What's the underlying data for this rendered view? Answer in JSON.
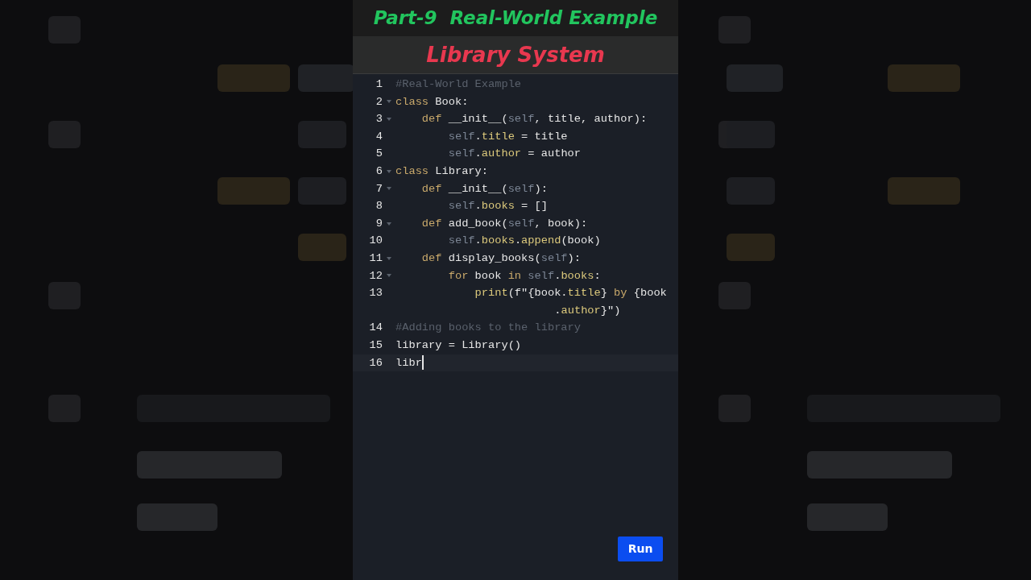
{
  "title": "Part-9  Real-World Example",
  "subtitle": "Library System",
  "editor": {
    "lines": [
      {
        "number": "1",
        "foldable": false,
        "current": false,
        "tokens": [
          {
            "kind": "comment",
            "text": "#Real-World Example"
          }
        ]
      },
      {
        "number": "2",
        "foldable": true,
        "current": false,
        "tokens": [
          {
            "kind": "keyword",
            "text": "class"
          },
          {
            "kind": "plain",
            "text": " Book:"
          }
        ]
      },
      {
        "number": "3",
        "foldable": true,
        "current": false,
        "tokens": [
          {
            "kind": "keyword",
            "text": "    def"
          },
          {
            "kind": "plain",
            "text": " __init__("
          },
          {
            "kind": "self",
            "text": "self"
          },
          {
            "kind": "plain",
            "text": ", title, author):"
          }
        ]
      },
      {
        "number": "4",
        "foldable": false,
        "current": false,
        "tokens": [
          {
            "kind": "self",
            "text": "        self"
          },
          {
            "kind": "plain",
            "text": "."
          },
          {
            "kind": "attr",
            "text": "title"
          },
          {
            "kind": "plain",
            "text": " = title"
          }
        ]
      },
      {
        "number": "5",
        "foldable": false,
        "current": false,
        "tokens": [
          {
            "kind": "self",
            "text": "        self"
          },
          {
            "kind": "plain",
            "text": "."
          },
          {
            "kind": "attr",
            "text": "author"
          },
          {
            "kind": "plain",
            "text": " = author"
          }
        ]
      },
      {
        "number": "6",
        "foldable": true,
        "current": false,
        "tokens": [
          {
            "kind": "keyword",
            "text": "class"
          },
          {
            "kind": "plain",
            "text": " Library:"
          }
        ]
      },
      {
        "number": "7",
        "foldable": true,
        "current": false,
        "tokens": [
          {
            "kind": "keyword",
            "text": "    def"
          },
          {
            "kind": "plain",
            "text": " __init__("
          },
          {
            "kind": "self",
            "text": "self"
          },
          {
            "kind": "plain",
            "text": "):"
          }
        ]
      },
      {
        "number": "8",
        "foldable": false,
        "current": false,
        "tokens": [
          {
            "kind": "self",
            "text": "        self"
          },
          {
            "kind": "plain",
            "text": "."
          },
          {
            "kind": "attr",
            "text": "books"
          },
          {
            "kind": "plain",
            "text": " = []"
          }
        ]
      },
      {
        "number": "9",
        "foldable": true,
        "current": false,
        "tokens": [
          {
            "kind": "keyword",
            "text": "    def"
          },
          {
            "kind": "plain",
            "text": " add_book("
          },
          {
            "kind": "self",
            "text": "self"
          },
          {
            "kind": "plain",
            "text": ", book):"
          }
        ]
      },
      {
        "number": "10",
        "foldable": false,
        "current": false,
        "tokens": [
          {
            "kind": "self",
            "text": "        self"
          },
          {
            "kind": "plain",
            "text": "."
          },
          {
            "kind": "attr",
            "text": "books"
          },
          {
            "kind": "plain",
            "text": "."
          },
          {
            "kind": "attr",
            "text": "append"
          },
          {
            "kind": "plain",
            "text": "(book)"
          }
        ]
      },
      {
        "number": "11",
        "foldable": true,
        "current": false,
        "tokens": [
          {
            "kind": "keyword",
            "text": "    def"
          },
          {
            "kind": "plain",
            "text": " display_books("
          },
          {
            "kind": "self",
            "text": "self"
          },
          {
            "kind": "plain",
            "text": "):"
          }
        ]
      },
      {
        "number": "12",
        "foldable": true,
        "current": false,
        "tokens": [
          {
            "kind": "keyword",
            "text": "        for"
          },
          {
            "kind": "plain",
            "text": " book "
          },
          {
            "kind": "keyword",
            "text": "in"
          },
          {
            "kind": "self",
            "text": " self"
          },
          {
            "kind": "plain",
            "text": "."
          },
          {
            "kind": "attr",
            "text": "books"
          },
          {
            "kind": "plain",
            "text": ":"
          }
        ]
      },
      {
        "number": "13",
        "foldable": false,
        "current": false,
        "tokens": [
          {
            "kind": "attr",
            "text": "            print"
          },
          {
            "kind": "plain",
            "text": "(f\"{book."
          },
          {
            "kind": "attr",
            "text": "title"
          },
          {
            "kind": "plain",
            "text": "} "
          },
          {
            "kind": "keyword",
            "text": "by"
          },
          {
            "kind": "plain",
            "text": " {book"
          }
        ],
        "wrap_tokens": [
          {
            "kind": "plain",
            "text": "."
          },
          {
            "kind": "attr",
            "text": "author"
          },
          {
            "kind": "plain",
            "text": "}\")"
          }
        ]
      },
      {
        "number": "14",
        "foldable": false,
        "current": false,
        "tokens": [
          {
            "kind": "comment",
            "text": "#Adding books to the library"
          }
        ]
      },
      {
        "number": "15",
        "foldable": false,
        "current": false,
        "tokens": [
          {
            "kind": "plain",
            "text": "library = Library()"
          }
        ]
      },
      {
        "number": "16",
        "foldable": false,
        "current": true,
        "cursor": true,
        "tokens": [
          {
            "kind": "plain",
            "text": "libr"
          }
        ]
      }
    ]
  },
  "run_button": "Run"
}
